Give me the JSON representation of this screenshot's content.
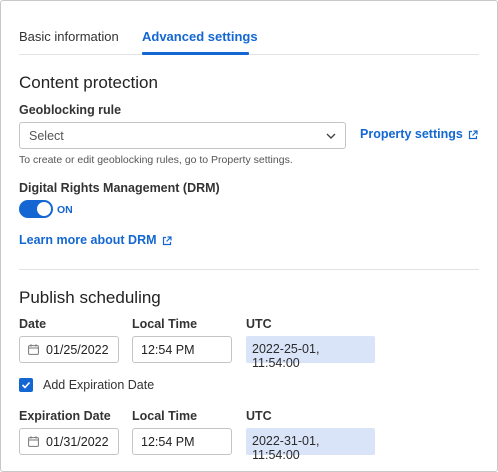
{
  "tabs": [
    {
      "label": "Basic information",
      "active": false
    },
    {
      "label": "Advanced settings",
      "active": true
    }
  ],
  "content_protection": {
    "heading": "Content protection",
    "geoblocking_label": "Geoblocking rule",
    "select_value": "Select",
    "property_link": "Property settings",
    "helper": "To create or edit geoblocking rules, go to Property settings.",
    "drm_label": "Digital Rights Management (DRM)",
    "drm_toggle_state": "ON",
    "learn_more_link": "Learn more about DRM"
  },
  "publish_scheduling": {
    "heading": "Publish scheduling",
    "publish": {
      "date_label": "Date",
      "local_time_label": "Local Time",
      "utc_label": "UTC",
      "date_value": "01/25/2022",
      "time_value": "12:54 PM",
      "utc_value": "2022-25-01, 11:54:00"
    },
    "expiration_checkbox_label": "Add Expiration Date",
    "expiration_checked": true,
    "expiration": {
      "date_label": "Expiration Date",
      "local_time_label": "Local Time",
      "utc_label": "UTC",
      "date_value": "01/31/2022",
      "time_value": "12:54 PM",
      "utc_value": "2022-31-01, 11:54:00"
    }
  },
  "colors": {
    "accent": "#1467d2",
    "utc_highlight": "#d9e4f8"
  },
  "icons": [
    "chevron-down-icon",
    "external-link-icon",
    "calendar-icon",
    "checkmark-icon"
  ]
}
